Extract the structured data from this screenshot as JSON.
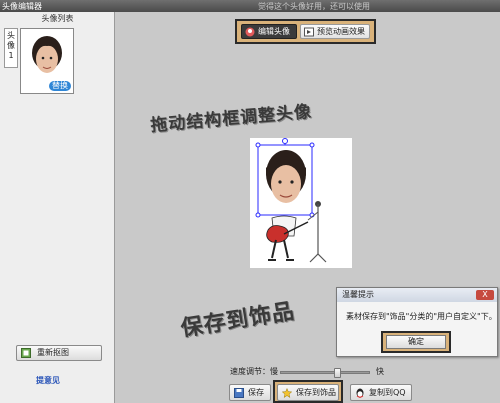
{
  "window": {
    "title": "头像编辑器",
    "slogan": "觉得这个头像好用，还可以使用"
  },
  "left_panel": {
    "header": "头像列表",
    "avatar_tab_label": "头像1",
    "replace_badge": "替换",
    "recapture_label": "重新抠图",
    "feedback_label": "提意见"
  },
  "toolbar": {
    "edit_label": "编辑头像",
    "preview_label": "预览动画效果"
  },
  "hints": {
    "drag": "拖动结构框调整头像",
    "save": "保存到饰品"
  },
  "dialog": {
    "title": "温馨提示",
    "close_label": "X",
    "message": "素材保存到\"饰品\"分类的\"用户自定义\"下。",
    "ok_label": "确定"
  },
  "speed": {
    "label": "速度调节：慢",
    "fast_label": "快",
    "value_fraction": 0.65
  },
  "bottom_buttons": {
    "save_label": "保存",
    "save_deco_label": "保存到饰品",
    "copy_qq_label": "复制到QQ"
  },
  "colors": {
    "highlight_box": "#d9b27a",
    "frame_blue": "#2a2aff",
    "link_blue": "#2a55b8",
    "badge_blue": "#2f86d6"
  }
}
